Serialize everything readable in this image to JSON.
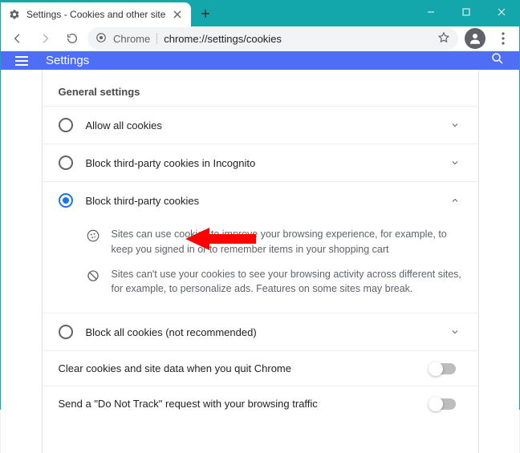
{
  "window": {
    "tab_title": "Settings - Cookies and other site"
  },
  "omnibox": {
    "scheme_label": "Chrome",
    "url_path": "chrome://settings/cookies"
  },
  "appbar": {
    "title": "Settings"
  },
  "settings": {
    "section_title": "General settings",
    "options": [
      {
        "label": "Allow all cookies",
        "selected": false,
        "expanded": false
      },
      {
        "label": "Block third-party cookies in Incognito",
        "selected": false,
        "expanded": false
      },
      {
        "label": "Block third-party cookies",
        "selected": true,
        "expanded": true
      },
      {
        "label": "Block all cookies (not recommended)",
        "selected": false,
        "expanded": false
      }
    ],
    "block3p_desc": [
      "Sites can use cookies to improve your browsing experience, for example, to keep you signed in or to remember items in your shopping cart",
      "Sites can't use your cookies to see your browsing activity across different sites, for example, to personalize ads. Features on some sites may break."
    ],
    "toggles": [
      {
        "label": "Clear cookies and site data when you quit Chrome",
        "on": false
      },
      {
        "label": "Send a \"Do Not Track\" request with your browsing traffic",
        "on": false
      }
    ]
  }
}
